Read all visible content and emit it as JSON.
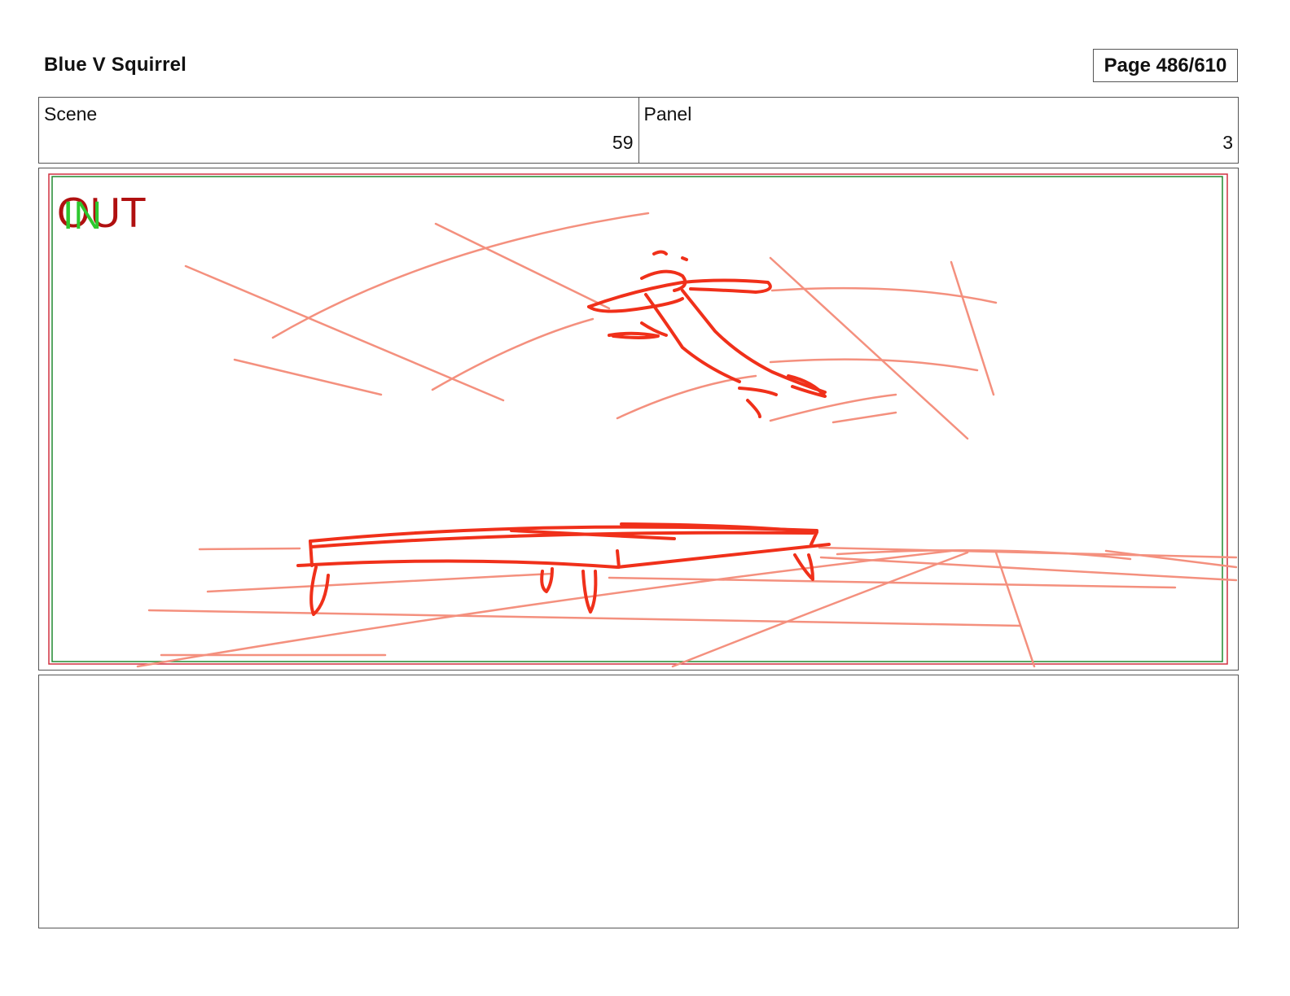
{
  "header": {
    "title": "Blue V Squirrel",
    "page_label": "Page 486/610"
  },
  "info": {
    "scene_label": "Scene",
    "scene_value": "59",
    "panel_label": "Panel",
    "panel_value": "3"
  },
  "panel": {
    "out_mark": "OUT",
    "in_mark": "IN",
    "colors": {
      "sketch_dark": "#f0301a",
      "sketch_light": "#f4907e",
      "out_mark": "#b01010",
      "in_mark": "#2ec82e",
      "frame_red": "#d03040",
      "frame_green": "#208a30"
    }
  },
  "notes": {
    "text": ""
  }
}
